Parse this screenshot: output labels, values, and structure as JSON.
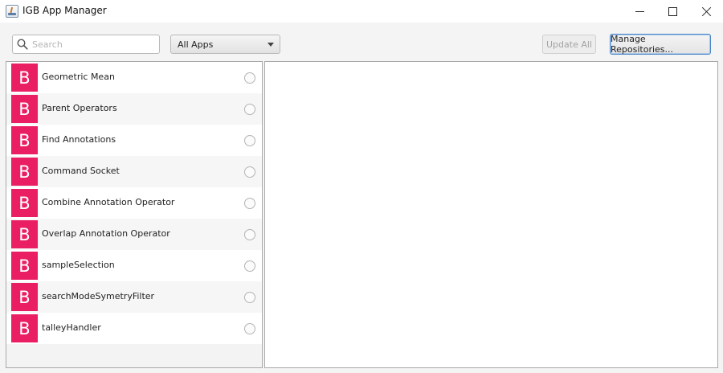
{
  "window": {
    "title": "IGB App Manager"
  },
  "toolbar": {
    "search_placeholder": "Search",
    "search_value": "",
    "filter_selected": "All Apps",
    "update_all_label": "Update All",
    "manage_repos_label": "Manage Repositories..."
  },
  "apps": [
    {
      "badge": "B",
      "name": "Geometric Mean"
    },
    {
      "badge": "B",
      "name": "Parent Operators"
    },
    {
      "badge": "B",
      "name": "Find Annotations"
    },
    {
      "badge": "B",
      "name": "Command Socket"
    },
    {
      "badge": "B",
      "name": "Combine Annotation Operator"
    },
    {
      "badge": "B",
      "name": "Overlap Annotation Operator"
    },
    {
      "badge": "B",
      "name": "sampleSelection"
    },
    {
      "badge": "B",
      "name": "searchModeSymetryFilter"
    },
    {
      "badge": "B",
      "name": "talleyHandler"
    }
  ],
  "colors": {
    "badge": "#e91e63",
    "focus_border": "#4a86c8"
  },
  "icons": {
    "window": "java-app-icon",
    "search": "search-icon",
    "dropdown": "chevron-down-icon",
    "minimize": "minimize-icon",
    "maximize": "maximize-icon",
    "close": "close-icon",
    "row_status": "radio-circle-icon"
  }
}
